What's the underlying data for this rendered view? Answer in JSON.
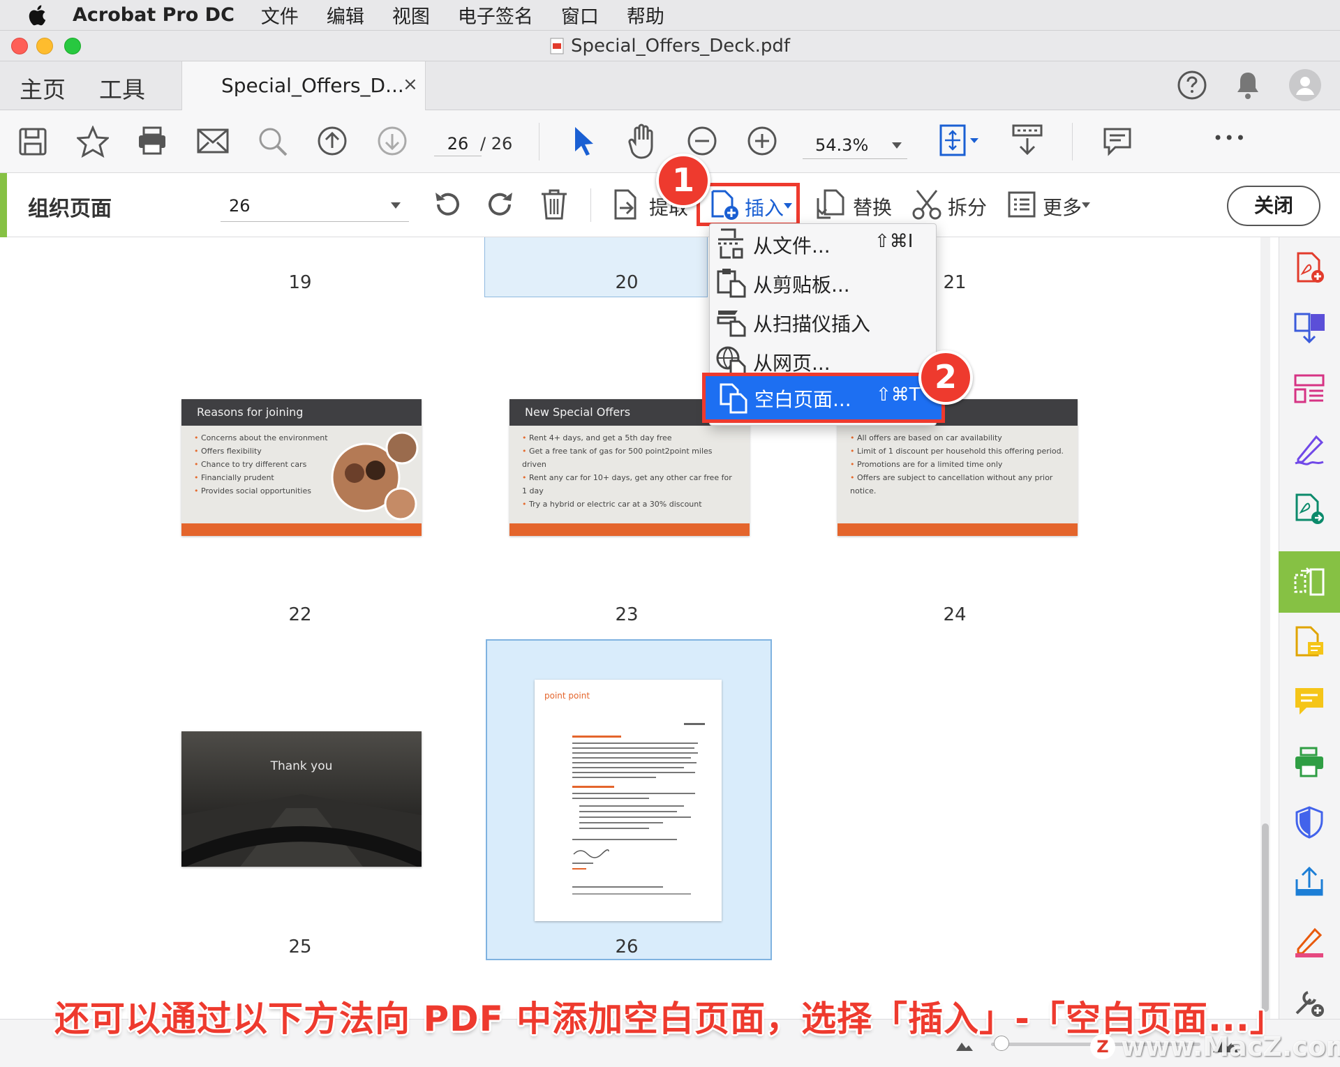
{
  "menubar": {
    "app_name": "Acrobat Pro DC",
    "items": [
      "文件",
      "编辑",
      "视图",
      "电子签名",
      "窗口",
      "帮助"
    ]
  },
  "window": {
    "title": "Special_Offers_Deck.pdf"
  },
  "tabs": {
    "home": "主页",
    "tools": "工具",
    "document": "Special_Offers_D...",
    "close_glyph": "×"
  },
  "toolbar": {
    "page_current": "26",
    "page_total": "/ 26",
    "zoom": "54.3%",
    "more_glyph": "•••"
  },
  "organize": {
    "title": "组织页面",
    "page_select": "26",
    "extract": "提取",
    "insert": "插入",
    "replace": "替换",
    "split": "拆分",
    "more": "更多",
    "close": "关闭"
  },
  "insert_menu": {
    "items": [
      {
        "label": "从文件...",
        "shortcut": "⇧⌘I",
        "icon": "file-insert-icon"
      },
      {
        "label": "从剪贴板...",
        "shortcut": "",
        "icon": "clipboard-icon"
      },
      {
        "label": "从扫描仪插入",
        "shortcut": "",
        "icon": "scanner-icon"
      },
      {
        "label": "从网页...",
        "shortcut": "",
        "icon": "globe-icon"
      },
      {
        "label": "空白页面...",
        "shortcut": "⇧⌘T",
        "icon": "blank-page-icon",
        "highlighted": true
      }
    ]
  },
  "badges": {
    "step1": "1",
    "step2": "2"
  },
  "pages": {
    "labels": [
      "19",
      "20",
      "21",
      "22",
      "23",
      "24",
      "25",
      "26"
    ],
    "slide22": {
      "title": "Reasons for joining",
      "bullets": [
        "Concerns about the environment",
        "Offers flexibility",
        "Chance to try different cars",
        "Financially prudent",
        "Provides social opportunities"
      ]
    },
    "slide23": {
      "title": "New Special Offers",
      "bullets": [
        "Rent 4+ days, and get a 5th day free",
        "Get a free tank of gas for 500 point2point miles driven",
        "Rent any car for 10+ days, get any other car free for 1 day",
        "Try a hybrid or electric car at a 30% discount"
      ]
    },
    "slide24": {
      "bullets": [
        "All offers are based on car availability",
        "Limit of 1 discount per household this offering period.",
        "Promotions are for a limited time only",
        "Offers are subject to cancellation without any prior notice."
      ]
    },
    "slide25": {
      "text": "Thank you"
    },
    "doc26": {
      "logo": "point point"
    }
  },
  "caption": "还可以通过以下方法向 PDF 中添加空白页面，选择「插入」-「空白页面...」",
  "watermark": "www.MacZ.com",
  "watermark_z": "Z",
  "colors": {
    "accent_green": "#86c144",
    "highlight_red": "#ee3a2e",
    "menu_selected": "#1d6ff2",
    "slide_orange": "#e4652c"
  }
}
